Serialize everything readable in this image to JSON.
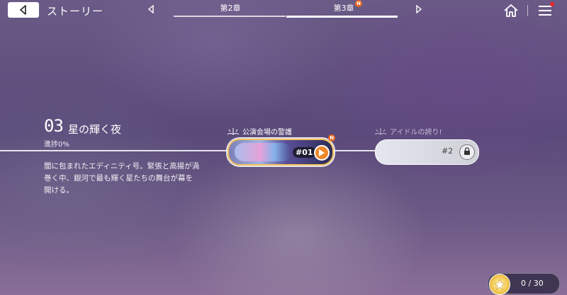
{
  "header": {
    "title": "ストーリー",
    "chapter_tabs": [
      {
        "label": "第2章",
        "active": false
      },
      {
        "label": "第3章",
        "active": true,
        "badge": "N"
      }
    ]
  },
  "chapter": {
    "number": "03",
    "name": "星の輝く夜",
    "progress": "進捗0%",
    "description": "闇に包まれたエディニティ号。緊張と高揚が渦巻く中、銀河で最も輝く星たちの舞台が幕を開ける。"
  },
  "episodes": [
    {
      "title": "公演会場の警護",
      "number": "#01",
      "badge": "N",
      "state": "playable",
      "icon": "play-icon"
    },
    {
      "title": "アイドルの誇り!",
      "number": "#2",
      "state": "locked",
      "icon": "lock-icon"
    }
  ],
  "stars": {
    "count": "0 / 30",
    "icon": "star-icon"
  },
  "colors": {
    "accent": "#f0882a",
    "new_badge": "#e8661f",
    "notification": "#e8262a"
  }
}
